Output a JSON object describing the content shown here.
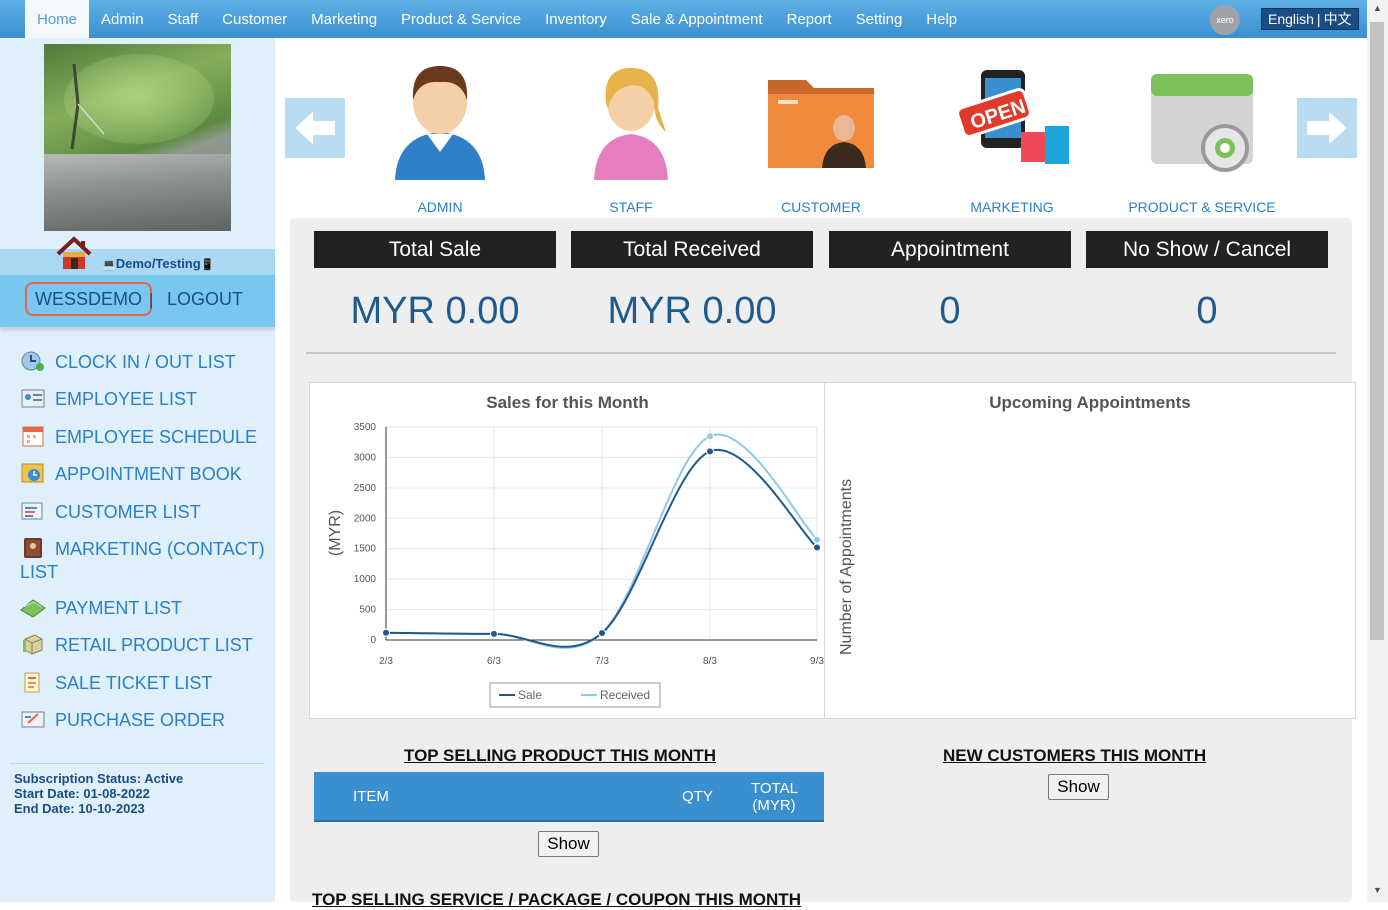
{
  "nav": {
    "items": [
      "Home",
      "Admin",
      "Staff",
      "Customer",
      "Marketing",
      "Product & Service",
      "Inventory",
      "Sale & Appointment",
      "Report",
      "Setting",
      "Help"
    ],
    "xero_label": "xero",
    "lang_en": "English",
    "lang_sep": "|",
    "lang_zh": "中文"
  },
  "sidebar": {
    "demo_label": "Demo/Testing",
    "username": "WESSDEMO",
    "separator": "|",
    "logout": "LOGOUT",
    "menu": [
      {
        "label": "CLOCK IN / OUT LIST",
        "icon": "clock-globe-icon"
      },
      {
        "label": "EMPLOYEE LIST",
        "icon": "employee-card-icon"
      },
      {
        "label": "EMPLOYEE SCHEDULE",
        "icon": "calendar-icon"
      },
      {
        "label": "APPOINTMENT BOOK",
        "icon": "appointment-book-icon"
      },
      {
        "label": "CUSTOMER LIST",
        "icon": "customer-list-icon"
      },
      {
        "label": "MARKETING (CONTACT) LIST",
        "icon": "contact-book-icon"
      },
      {
        "label": "PAYMENT LIST",
        "icon": "money-icon"
      },
      {
        "label": "RETAIL PRODUCT LIST",
        "icon": "product-box-icon"
      },
      {
        "label": "SALE TICKET LIST",
        "icon": "ticket-icon"
      },
      {
        "label": "PURCHASE ORDER",
        "icon": "purchase-order-icon"
      }
    ],
    "subscription": {
      "status": "Subscription Status: Active",
      "start": "Start Date: 01-08-2022",
      "end": "End Date: 10-10-2023"
    }
  },
  "carousel": [
    {
      "label": "ADMIN",
      "icon": "admin-person-icon"
    },
    {
      "label": "STAFF",
      "icon": "staff-person-icon"
    },
    {
      "label": "CUSTOMER",
      "icon": "customer-folder-icon"
    },
    {
      "label": "MARKETING",
      "icon": "marketing-open-sign-icon"
    },
    {
      "label": "PRODUCT & SERVICE",
      "icon": "product-gear-icon"
    }
  ],
  "stats": [
    {
      "title": "Total Sale",
      "value": "MYR 0.00"
    },
    {
      "title": "Total Received",
      "value": "MYR 0.00"
    },
    {
      "title": "Appointment",
      "value": "0"
    },
    {
      "title": "No Show / Cancel",
      "value": "0"
    }
  ],
  "colors": {
    "sale": "#1f5a8e",
    "received": "#8ec9e8",
    "accent": "#3a8fcf"
  },
  "chart_data": {
    "type": "line",
    "title": "Sales for this Month",
    "xlabel": "",
    "ylabel": "(MYR)",
    "categories": [
      "2/3",
      "6/3",
      "7/3",
      "8/3",
      "9/3"
    ],
    "ylim": [
      0,
      3500
    ],
    "yticks": [
      0,
      500,
      1000,
      1500,
      2000,
      2500,
      3000,
      3500
    ],
    "grid": true,
    "legend_position": "bottom",
    "series": [
      {
        "name": "Sale",
        "values": [
          120,
          100,
          115,
          3100,
          1520
        ]
      },
      {
        "name": "Received",
        "values": [
          120,
          100,
          115,
          3350,
          1650
        ]
      }
    ]
  },
  "appointments": {
    "title": "Upcoming Appointments",
    "ylabel": "Number of Appointments"
  },
  "top_product": {
    "title": "TOP SELLING PRODUCT THIS MONTH",
    "columns": [
      "ITEM",
      "QTY",
      "TOTAL",
      "(MYR)"
    ],
    "show_label": "Show"
  },
  "new_customers": {
    "title": "NEW CUSTOMERS THIS MONTH",
    "show_label": "Show"
  },
  "top_service": {
    "title": "TOP SELLING SERVICE / PACKAGE / COUPON THIS MONTH"
  }
}
